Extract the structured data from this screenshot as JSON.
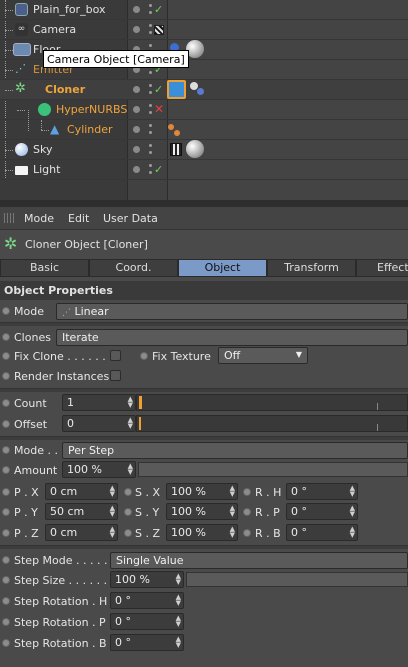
{
  "object_manager": {
    "rows": [
      {
        "name": "Plain_for_box"
      },
      {
        "name": "Camera"
      },
      {
        "name": "Floor"
      },
      {
        "name": "Emitter"
      },
      {
        "name": "Cloner"
      },
      {
        "name": "HyperNURBS"
      },
      {
        "name": "Cylinder"
      },
      {
        "name": "Sky"
      },
      {
        "name": "Light"
      }
    ],
    "tooltip": "Camera Object [Camera]",
    "colors": {
      "selected_orange": "#f2a43a",
      "check_green": "#6fd15a",
      "cross_red": "#e04040"
    }
  },
  "attr_menu": {
    "mode": "Mode",
    "edit": "Edit",
    "user_data": "User Data"
  },
  "header": {
    "title": "Cloner Object [Cloner]"
  },
  "tabs": [
    {
      "label": "Basic"
    },
    {
      "label": "Coord."
    },
    {
      "label": "Object",
      "active": true
    },
    {
      "label": "Transform"
    },
    {
      "label": "Effectors"
    }
  ],
  "section": {
    "title": "Object Properties"
  },
  "fields": {
    "mode_label": "Mode",
    "mode_value": "Linear",
    "clones_label": "Clones",
    "clones_value": "Iterate",
    "fix_clone_label": "Fix Clone . . . . . . .",
    "fix_texture_label": "Fix Texture",
    "fix_texture_value": "Off",
    "render_instances_label": "Render Instances",
    "count_label": "Count",
    "count_value": "1",
    "offset_label": "Offset",
    "offset_value": "0",
    "mode2_label": "Mode . .",
    "mode2_value": "Per Step",
    "amount_label": "Amount",
    "amount_value": "100 %",
    "px_label": "P . X",
    "px_value": "0 cm",
    "py_label": "P . Y",
    "py_value": "50 cm",
    "pz_label": "P . Z",
    "pz_value": "0 cm",
    "sx_label": "S . X",
    "sx_value": "100 %",
    "sy_label": "S . Y",
    "sy_value": "100 %",
    "sz_label": "S . Z",
    "sz_value": "100 %",
    "rh_label": "R . H",
    "rh_value": "0 °",
    "rp_label": "R . P",
    "rp_value": "0 °",
    "rb_label": "R . B",
    "rb_value": "0 °",
    "step_mode_label": "Step Mode . . . . . . .",
    "step_mode_value": "Single Value",
    "step_size_label": "Step Size . . . . . . .",
    "step_size_value": "100 %",
    "step_rot_h_label": "Step Rotation . H",
    "step_rot_h_value": "0 °",
    "step_rot_p_label": "Step Rotation . P",
    "step_rot_p_value": "0 °",
    "step_rot_b_label": "Step Rotation . B",
    "step_rot_b_value": "0 °"
  }
}
